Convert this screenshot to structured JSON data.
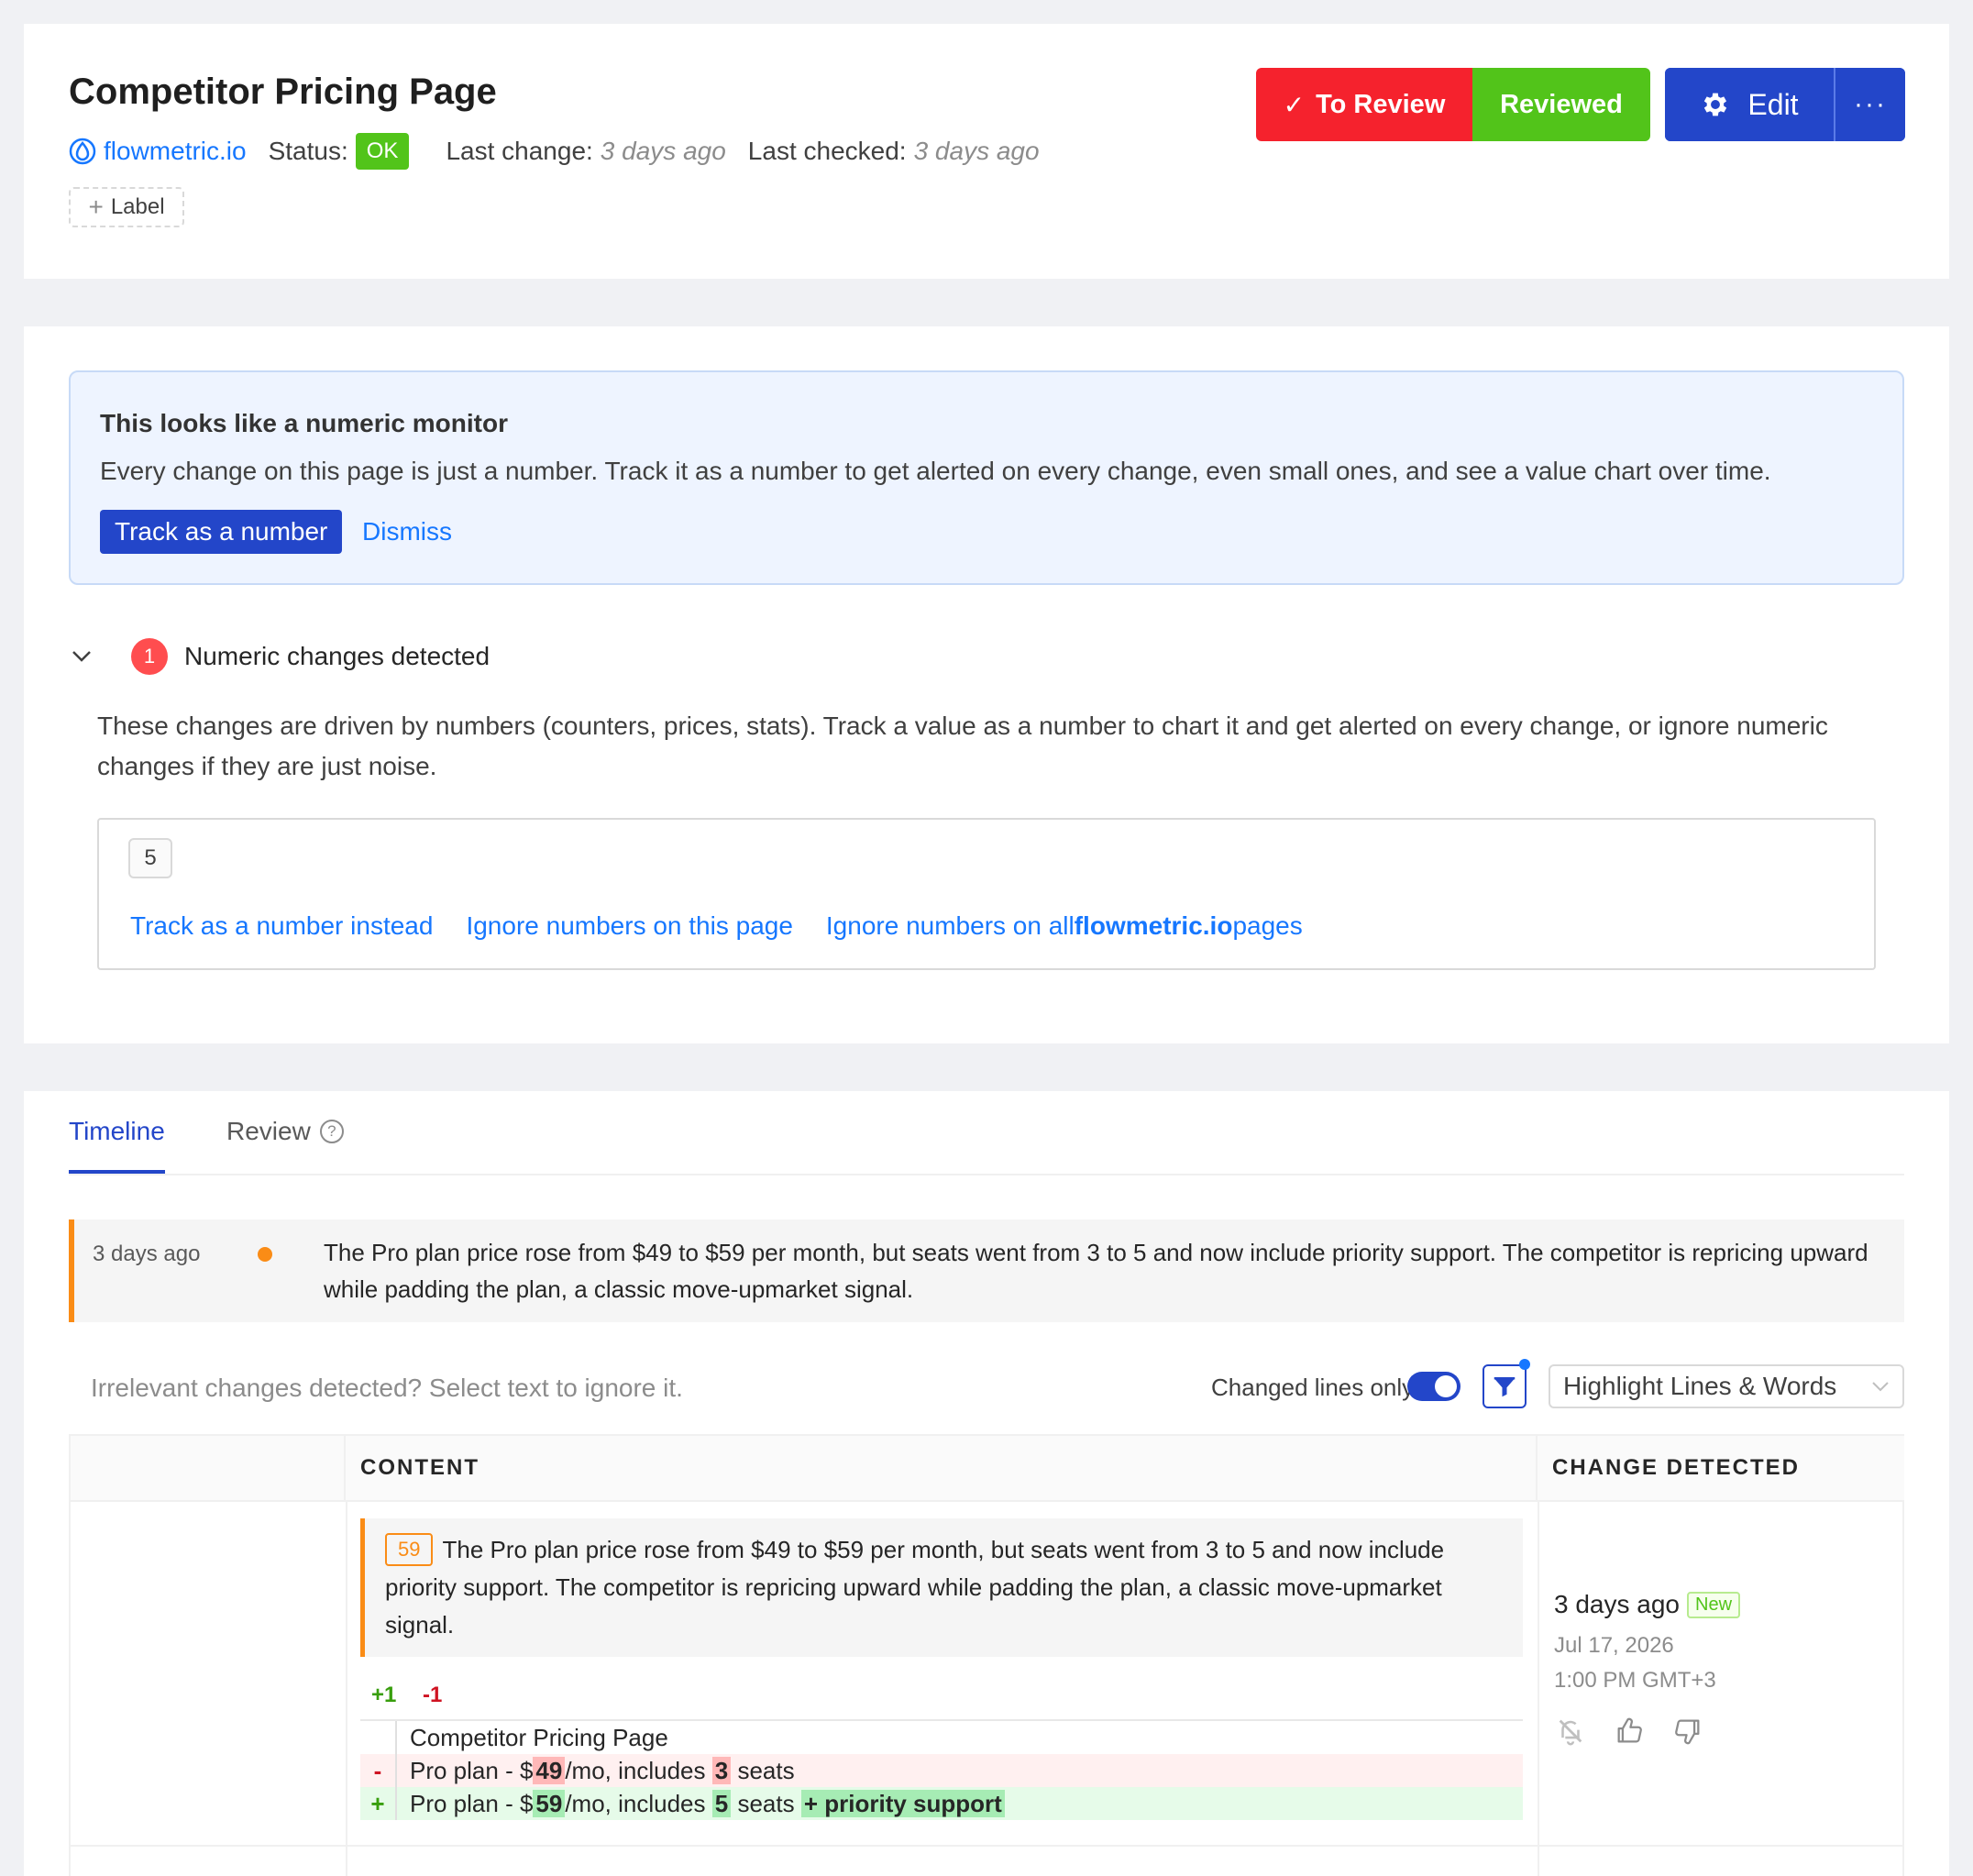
{
  "header": {
    "title": "Competitor Pricing Page",
    "site": "flowmetric.io",
    "status_label": "Status:",
    "status_value": "OK",
    "last_change_label": "Last change:",
    "last_change_value": "3 days ago",
    "last_checked_label": "Last checked:",
    "last_checked_value": "3 days ago",
    "label_button": "Label",
    "to_review_button": "To Review",
    "reviewed_button": "Reviewed",
    "edit_button": "Edit",
    "more_button": "···"
  },
  "suggestion": {
    "title": "This looks like a numeric monitor",
    "text": "Every change on this page is just a number. Track it as a number to get alerted on every change, even small ones, and see a value chart over time.",
    "track_button": "Track as a number",
    "dismiss_link": "Dismiss"
  },
  "numeric_changes": {
    "count": "1",
    "title": "Numeric changes detected",
    "description": "These changes are driven by numbers (counters, prices, stats). Track a value as a number to chart it and get alerted on every change, or ignore numeric changes if they are just noise.",
    "value_chip": "5",
    "track_link": "Track as a number instead",
    "ignore_page_link": "Ignore numbers on this page",
    "ignore_all_prefix": "Ignore numbers on all",
    "ignore_all_domain": "flowmetric.io",
    "ignore_all_suffix": "pages"
  },
  "tabs": {
    "timeline": "Timeline",
    "review": "Review"
  },
  "timeline_event": {
    "time": "3 days ago",
    "text": "The Pro plan price rose from $49 to $59 per month, but seats went from 3 to 5 and now include priority support. The competitor is repricing upward while padding the plan, a classic move-upmarket signal."
  },
  "toolbar": {
    "hint": "Irrelevant changes detected? Select text to ignore it.",
    "changed_lines_label": "Changed lines only",
    "highlight_select": "Highlight Lines & Words"
  },
  "table": {
    "col_content": "CONTENT",
    "col_change_detected": "CHANGE DETECTED",
    "row": {
      "value_chip": "59",
      "summary": "The Pro plan price rose from $49 to $59 per month, but seats went from 3 to 5 and now include priority support. The competitor is repricing upward while padding the plan, a classic move-upmarket signal.",
      "added_count": "+1",
      "removed_count": "-1",
      "context_line": "Competitor Pricing Page",
      "del_marker": "-",
      "del_prefix": "Pro plan - $",
      "del_price": "49",
      "del_mid": "/mo, includes",
      "del_seats": "3",
      "del_suffix": "seats",
      "add_marker": "+",
      "add_prefix": "Pro plan - $",
      "add_price": "59",
      "add_mid": "/mo, includes",
      "add_seats": "5",
      "add_suffix": "seats",
      "add_extra": "+ priority support",
      "detected_relative": "3 days ago",
      "new_tag": "New",
      "detected_date": "Jul 17, 2026",
      "detected_time": "1:00 PM GMT+3"
    }
  },
  "colors": {
    "primary": "#2346c9",
    "danger": "#f5222d",
    "success": "#52c41a",
    "warning": "#fa8c16",
    "link": "#1677ff"
  }
}
